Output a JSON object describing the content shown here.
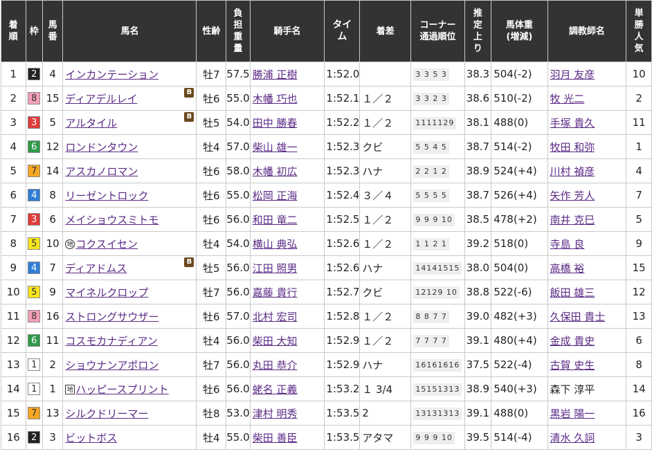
{
  "headers": [
    "着順",
    "枠",
    "馬番",
    "馬名",
    "性齢",
    "負担重量",
    "騎手名",
    "タイム",
    "着差",
    "コーナー通過順位",
    "推定上り",
    "馬体重(増減)",
    "調教師名",
    "単勝人気"
  ],
  "header_display": {
    "rank": "着\n順",
    "waku": "枠",
    "umaban": "馬\n番",
    "horse": "馬名",
    "sexage": "性齢",
    "weight": "負\n担\n重\n量",
    "jockey": "騎手名",
    "time": "タイ\nム",
    "margin": "着差",
    "corner": "コーナー\n通過順位",
    "last3f": "推\n定\n上\nり",
    "body": "馬体重\n(増減)",
    "trainer": "調教師名",
    "pop": "単\n勝\n人\n気"
  },
  "waku_colors": {
    "1": {
      "bg": "#ffffff",
      "fg": "#333333"
    },
    "2": {
      "bg": "#222222",
      "fg": "#ffffff"
    },
    "3": {
      "bg": "#e03b3b",
      "fg": "#ffffff"
    },
    "4": {
      "bg": "#2f7ed8",
      "fg": "#ffffff"
    },
    "5": {
      "bg": "#f7e61c",
      "fg": "#333333"
    },
    "6": {
      "bg": "#2e9a4a",
      "fg": "#ffffff"
    },
    "7": {
      "bg": "#f5a623",
      "fg": "#333333"
    },
    "8": {
      "bg": "#f5a0b8",
      "fg": "#333333"
    }
  },
  "rows": [
    {
      "rank": "1",
      "waku": "2",
      "umaban": "4",
      "horse": "インカンテーション",
      "blinker": "",
      "mark": "",
      "sexage": "牡7",
      "weight": "57.5",
      "jockey": "勝浦 正樹",
      "time": "1:52.0",
      "margin": "",
      "corner": "3 3 5 3",
      "last3f": "38.3",
      "body": "504(-2)",
      "trainer": "羽月 友彦",
      "trainer_link": true,
      "pop": "10"
    },
    {
      "rank": "2",
      "waku": "8",
      "umaban": "15",
      "horse": "ディアデルレイ",
      "blinker": "B",
      "mark": "",
      "sexage": "牡6",
      "weight": "55.0",
      "jockey": "木幡 巧也",
      "time": "1:52.1",
      "margin": "１／２",
      "corner": "3 3 2 3",
      "last3f": "38.6",
      "body": "510(-2)",
      "trainer": "牧 光二",
      "trainer_link": true,
      "pop": "2"
    },
    {
      "rank": "3",
      "waku": "3",
      "umaban": "5",
      "horse": "アルタイル",
      "blinker": "B",
      "mark": "",
      "sexage": "牡5",
      "weight": "54.0",
      "jockey": "田中 勝春",
      "time": "1:52.2",
      "margin": "１／２",
      "corner": "1111129",
      "last3f": "38.1",
      "body": "488(0)",
      "trainer": "手塚 貴久",
      "trainer_link": true,
      "pop": "11"
    },
    {
      "rank": "4",
      "waku": "6",
      "umaban": "12",
      "horse": "ロンドンタウン",
      "blinker": "",
      "mark": "",
      "sexage": "牡4",
      "weight": "57.0",
      "jockey": "柴山 雄一",
      "time": "1:52.3",
      "margin": "クビ",
      "corner": "5 5 4 5",
      "last3f": "38.7",
      "body": "514(-2)",
      "trainer": "牧田 和弥",
      "trainer_link": true,
      "pop": "1"
    },
    {
      "rank": "5",
      "waku": "7",
      "umaban": "14",
      "horse": "アスカノロマン",
      "blinker": "",
      "mark": "",
      "sexage": "牡6",
      "weight": "58.0",
      "jockey": "木幡 初広",
      "time": "1:52.3",
      "margin": "ハナ",
      "corner": "2 2 1 2",
      "last3f": "38.9",
      "body": "524(+4)",
      "trainer": "川村 禎彦",
      "trainer_link": true,
      "pop": "4"
    },
    {
      "rank": "6",
      "waku": "4",
      "umaban": "8",
      "horse": "リーゼントロック",
      "blinker": "",
      "mark": "",
      "sexage": "牡6",
      "weight": "55.0",
      "jockey": "松岡 正海",
      "time": "1:52.4",
      "margin": "３／４",
      "corner": "5 5 5 5",
      "last3f": "38.7",
      "body": "526(+4)",
      "trainer": "矢作 芳人",
      "trainer_link": true,
      "pop": "7"
    },
    {
      "rank": "7",
      "waku": "3",
      "umaban": "6",
      "horse": "メイショウスミトモ",
      "blinker": "",
      "mark": "",
      "sexage": "牡6",
      "weight": "56.0",
      "jockey": "和田 竜二",
      "time": "1:52.5",
      "margin": "１／２",
      "corner": "9 9 9 10",
      "last3f": "38.5",
      "body": "478(+2)",
      "trainer": "南井 克巳",
      "trainer_link": true,
      "pop": "5"
    },
    {
      "rank": "8",
      "waku": "5",
      "umaban": "10",
      "horse": "コクスイセン",
      "blinker": "",
      "mark": "地",
      "mark_shape": "circle",
      "sexage": "牡4",
      "weight": "54.0",
      "jockey": "横山 典弘",
      "time": "1:52.6",
      "margin": "１／２",
      "corner": "1 1 2 1",
      "last3f": "39.2",
      "body": "518(0)",
      "trainer": "寺島 良",
      "trainer_link": true,
      "pop": "9"
    },
    {
      "rank": "9",
      "waku": "4",
      "umaban": "7",
      "horse": "ディアドムス",
      "blinker": "B",
      "mark": "",
      "sexage": "牡5",
      "weight": "56.0",
      "jockey": "江田 照男",
      "time": "1:52.6",
      "margin": "ハナ",
      "corner": "14141515",
      "last3f": "38.0",
      "body": "504(0)",
      "trainer": "高橋 裕",
      "trainer_link": true,
      "pop": "15"
    },
    {
      "rank": "10",
      "waku": "5",
      "umaban": "9",
      "horse": "マイネルクロップ",
      "blinker": "",
      "mark": "",
      "sexage": "牡7",
      "weight": "56.0",
      "jockey": "嘉藤 貴行",
      "time": "1:52.7",
      "margin": "クビ",
      "corner": "12129 10",
      "last3f": "38.8",
      "body": "522(-6)",
      "trainer": "飯田 雄三",
      "trainer_link": true,
      "pop": "12"
    },
    {
      "rank": "11",
      "waku": "8",
      "umaban": "16",
      "horse": "ストロングサウザー",
      "blinker": "",
      "mark": "",
      "sexage": "牡6",
      "weight": "57.0",
      "jockey": "北村 宏司",
      "time": "1:52.8",
      "margin": "１／２",
      "corner": "8 8 7 7",
      "last3f": "39.0",
      "body": "482(+3)",
      "trainer": "久保田 貴士",
      "trainer_link": true,
      "pop": "13"
    },
    {
      "rank": "12",
      "waku": "6",
      "umaban": "11",
      "horse": "コスモカナディアン",
      "blinker": "",
      "mark": "",
      "sexage": "牡4",
      "weight": "56.0",
      "jockey": "柴田 大知",
      "time": "1:52.9",
      "margin": "１／２",
      "corner": "7 7 7 7",
      "last3f": "39.1",
      "body": "480(+4)",
      "trainer": "金成 貴史",
      "trainer_link": true,
      "pop": "6"
    },
    {
      "rank": "13",
      "waku": "1",
      "umaban": "2",
      "horse": "ショウナンアポロン",
      "blinker": "",
      "mark": "",
      "sexage": "牡7",
      "weight": "56.0",
      "jockey": "丸田 恭介",
      "time": "1:52.9",
      "margin": "ハナ",
      "corner": "16161616",
      "last3f": "37.5",
      "body": "522(-4)",
      "trainer": "古賀 史生",
      "trainer_link": true,
      "pop": "8"
    },
    {
      "rank": "14",
      "waku": "1",
      "umaban": "1",
      "horse": "ハッピースプリント",
      "blinker": "",
      "mark": "地",
      "mark_shape": "square",
      "sexage": "牡6",
      "weight": "56.0",
      "jockey": "蛯名 正義",
      "time": "1:53.2",
      "margin": "１ 3/4",
      "corner": "15151313",
      "last3f": "38.9",
      "body": "540(+3)",
      "trainer": "森下 淳平",
      "trainer_link": false,
      "pop": "14"
    },
    {
      "rank": "15",
      "waku": "7",
      "umaban": "13",
      "horse": "シルクドリーマー",
      "blinker": "",
      "mark": "",
      "sexage": "牡8",
      "weight": "53.0",
      "jockey": "津村 明秀",
      "time": "1:53.5",
      "margin": "2",
      "corner": "13131313",
      "last3f": "39.1",
      "body": "488(0)",
      "trainer": "黒岩 陽一",
      "trainer_link": true,
      "pop": "16"
    },
    {
      "rank": "16",
      "waku": "2",
      "umaban": "3",
      "horse": "ビットボス",
      "blinker": "",
      "mark": "",
      "sexage": "牡4",
      "weight": "55.0",
      "jockey": "柴田 善臣",
      "time": "1:53.5",
      "margin": "アタマ",
      "corner": "9 9 9 10",
      "last3f": "39.5",
      "body": "514(-4)",
      "trainer": "清水 久詞",
      "trainer_link": true,
      "pop": "3"
    }
  ]
}
